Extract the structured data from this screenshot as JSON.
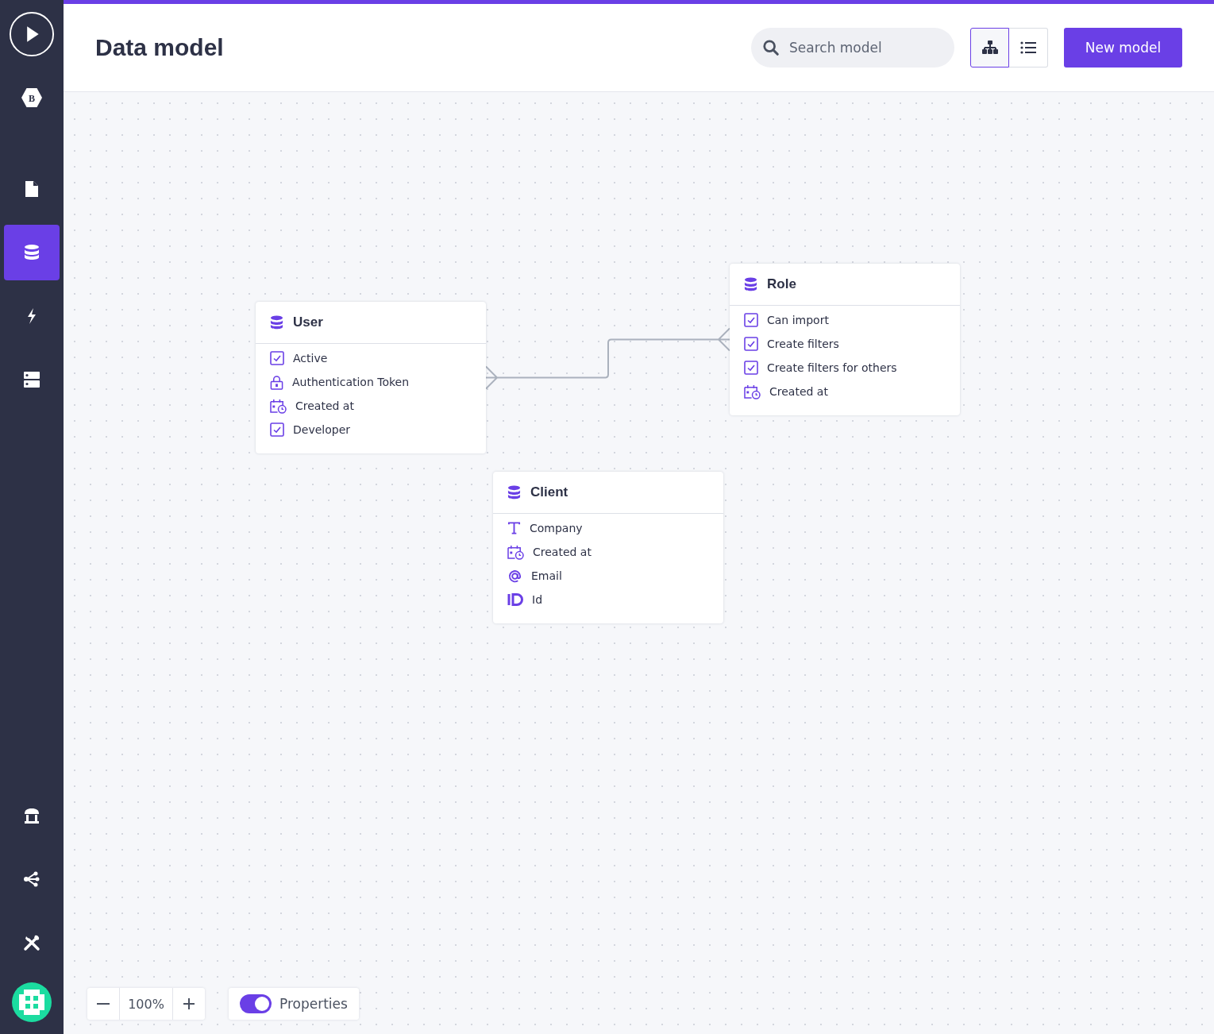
{
  "sidebar": {
    "items": [
      {
        "kind": "play",
        "selected": false
      },
      {
        "kind": "logo",
        "label": "B",
        "selected": false
      },
      {
        "kind": "file",
        "selected": false
      },
      {
        "kind": "database",
        "selected": true
      },
      {
        "kind": "bolt",
        "selected": false
      },
      {
        "kind": "server",
        "selected": false
      },
      {
        "kind": "store",
        "selected": false
      },
      {
        "kind": "share",
        "selected": false
      },
      {
        "kind": "tools",
        "selected": false
      },
      {
        "kind": "avatar",
        "selected": false
      }
    ]
  },
  "header": {
    "title": "Data model",
    "search": {
      "placeholder": "Search model"
    },
    "view_toggle": [
      {
        "kind": "diagram",
        "selected": true
      },
      {
        "kind": "list",
        "selected": false
      }
    ],
    "new_button": "New model"
  },
  "models": [
    {
      "name": "User",
      "fields": [
        {
          "kind": "boolean",
          "label": "Active"
        },
        {
          "kind": "password",
          "label": "Authentication Token"
        },
        {
          "kind": "datetime",
          "label": "Created at"
        },
        {
          "kind": "boolean",
          "label": "Developer"
        }
      ]
    },
    {
      "name": "Role",
      "fields": [
        {
          "kind": "boolean",
          "label": "Can import"
        },
        {
          "kind": "boolean",
          "label": "Create filters"
        },
        {
          "kind": "boolean",
          "label": "Create filters for others"
        },
        {
          "kind": "datetime",
          "label": "Created at"
        }
      ]
    },
    {
      "name": "Client",
      "fields": [
        {
          "kind": "text",
          "label": "Company"
        },
        {
          "kind": "datetime",
          "label": "Created at"
        },
        {
          "kind": "email",
          "label": "Email"
        },
        {
          "kind": "id",
          "label": "Id"
        }
      ]
    }
  ],
  "zoom": {
    "value": "100%"
  },
  "properties_toggle": {
    "label": "Properties",
    "on": true
  }
}
